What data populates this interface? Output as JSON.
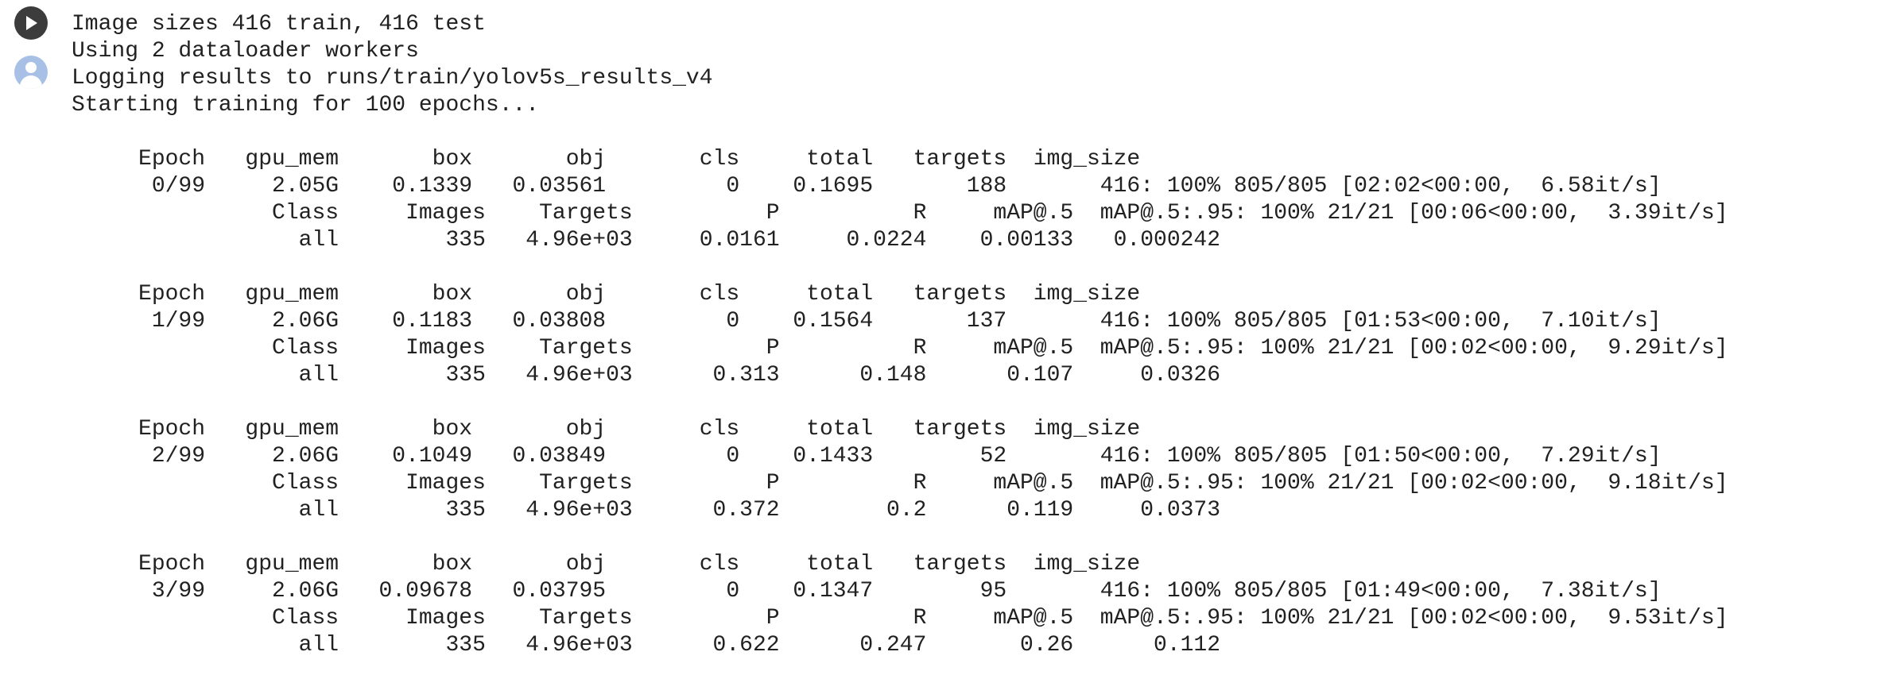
{
  "output_lines": [
    "Image sizes 416 train, 416 test",
    "Using 2 dataloader workers",
    "Logging results to runs/train/yolov5s_results_v4",
    "Starting training for 100 epochs...",
    "",
    "     Epoch   gpu_mem       box       obj       cls     total   targets  img_size",
    "      0/99     2.05G    0.1339   0.03561         0    0.1695       188       416: 100% 805/805 [02:02<00:00,  6.58it/s]",
    "               Class     Images    Targets          P          R     mAP@.5  mAP@.5:.95: 100% 21/21 [00:06<00:00,  3.39it/s]",
    "                 all        335   4.96e+03     0.0161     0.0224    0.00133   0.000242",
    "",
    "     Epoch   gpu_mem       box       obj       cls     total   targets  img_size",
    "      1/99     2.06G    0.1183   0.03808         0    0.1564       137       416: 100% 805/805 [01:53<00:00,  7.10it/s]",
    "               Class     Images    Targets          P          R     mAP@.5  mAP@.5:.95: 100% 21/21 [00:02<00:00,  9.29it/s]",
    "                 all        335   4.96e+03      0.313      0.148      0.107     0.0326",
    "",
    "     Epoch   gpu_mem       box       obj       cls     total   targets  img_size",
    "      2/99     2.06G    0.1049   0.03849         0    0.1433        52       416: 100% 805/805 [01:50<00:00,  7.29it/s]",
    "               Class     Images    Targets          P          R     mAP@.5  mAP@.5:.95: 100% 21/21 [00:02<00:00,  9.18it/s]",
    "                 all        335   4.96e+03      0.372        0.2      0.119     0.0373",
    "",
    "     Epoch   gpu_mem       box       obj       cls     total   targets  img_size",
    "      3/99     2.06G   0.09678   0.03795         0    0.1347        95       416: 100% 805/805 [01:49<00:00,  7.38it/s]",
    "               Class     Images    Targets          P          R     mAP@.5  mAP@.5:.95: 100% 21/21 [00:02<00:00,  9.53it/s]",
    "                 all        335   4.96e+03      0.622      0.247       0.26      0.112"
  ],
  "icons": {
    "run": "play-icon",
    "user": "user-avatar-icon"
  },
  "colors": {
    "text": "#212121",
    "run_button": "#3c3c3c",
    "avatar": "#a8c0e6"
  }
}
